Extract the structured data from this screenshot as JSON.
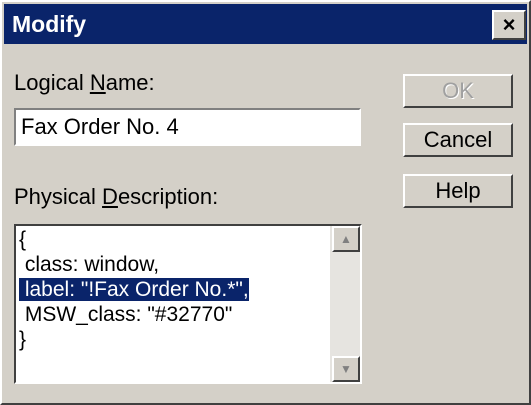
{
  "window": {
    "title": "Modify",
    "close_glyph": "×"
  },
  "logical_name": {
    "label_prefix": "Logical ",
    "label_accel": "N",
    "label_suffix": "ame:",
    "value": "Fax Order No. 4"
  },
  "physical_description": {
    "label_prefix": "Physical ",
    "label_accel": "D",
    "label_suffix": "escription:",
    "lines": [
      "{",
      " class: window,",
      " label: \"!Fax Order No.*\",",
      " MSW_class: \"#32770\"",
      "}"
    ],
    "selected_line_index": 2
  },
  "buttons": {
    "ok": {
      "label": "OK",
      "enabled": false
    },
    "cancel": {
      "label": "Cancel",
      "enabled": true
    },
    "help": {
      "label": "Help",
      "enabled": true
    }
  },
  "scrollbar": {
    "up_glyph": "▲",
    "down_glyph": "▼"
  },
  "colors": {
    "titlebar": "#0a246a",
    "selection": "#0a246a",
    "face": "#d4d0c8"
  }
}
